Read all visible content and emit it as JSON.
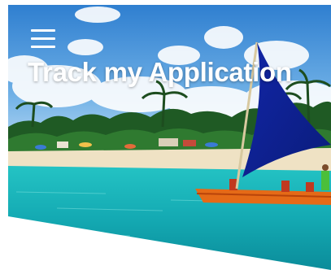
{
  "header": {
    "title": "Track my Application",
    "menu_icon": "hamburger-menu-icon"
  },
  "hero": {
    "image": "beach-sailboat-photo"
  }
}
